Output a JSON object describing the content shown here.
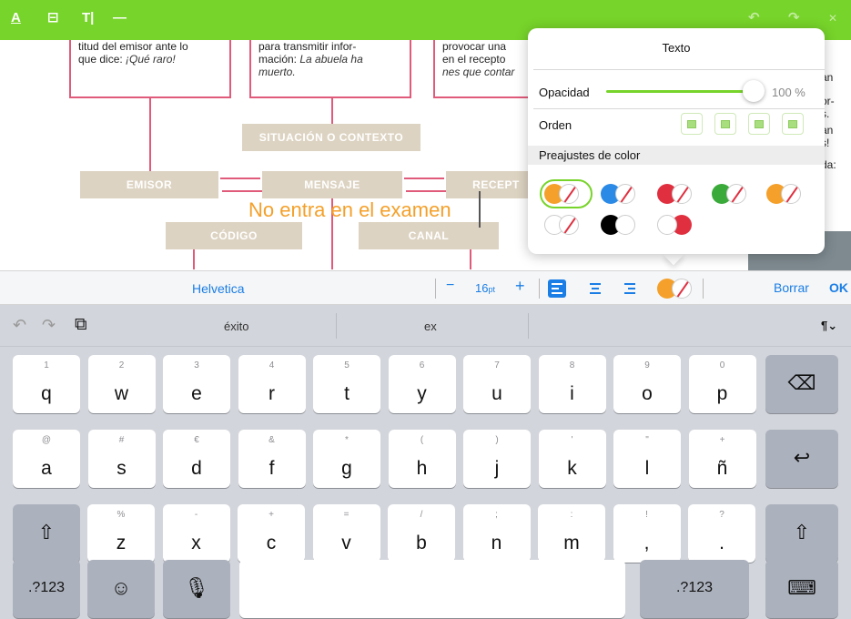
{
  "toolbar": {
    "icons": [
      "text-format-icon",
      "comment-icon",
      "text-tool-icon",
      "line-icon",
      "undo-icon",
      "redo-icon",
      "close-icon"
    ],
    "glyph_format": "A",
    "glyph_comment": "⊟",
    "glyph_text": "T|",
    "glyph_line": "—",
    "glyph_undo": "↶",
    "glyph_redo": "↷",
    "glyph_close": "✕",
    "color": "#77d42a"
  },
  "document": {
    "card1_line1": "titud del emisor ante lo",
    "card1_line2_a": "que dice: ",
    "card1_line2_b": "¡Qué raro!",
    "card2_line1": "para transmitir infor-",
    "card2_line2_a": "mación: ",
    "card2_line2_b": "La abuela ha",
    "card2_line3": "muerto.",
    "card3_line1": "provocar una",
    "card3_line2": "en el recepto",
    "card3_line3": "nes que contar",
    "right_frag1": "an",
    "right_frag2": "or-",
    "right_frag3": "s.",
    "right_frag4": "an",
    "right_frag5": "s!",
    "right_frag6": "da:",
    "tag_situacion": "SITUACIÓN O CONTEXTO",
    "tag_emisor": "EMISOR",
    "tag_mensaje": "MENSAJE",
    "tag_receptor": "RECEPT",
    "tag_codigo": "CÓDIGO",
    "tag_canal": "CANAL",
    "overlay_text": "No entra en el examen",
    "overlay_color": "#f4a02a",
    "arrow_color": "#e05a7a",
    "tag_color": "#ddd3c2"
  },
  "popover": {
    "title": "Texto",
    "opacity_label": "Opacidad",
    "opacity_value": "100 %",
    "order_label": "Orden",
    "presets_label": "Preajustes de color",
    "presets": [
      {
        "name": "orange",
        "color": "#f4a02a"
      },
      {
        "name": "blue",
        "color": "#2a8ae6"
      },
      {
        "name": "red",
        "color": "#e03040"
      },
      {
        "name": "green",
        "color": "#3aaa3a"
      },
      {
        "name": "orange-2",
        "color": "#f4a02a"
      },
      {
        "name": "white",
        "color": "#ffffff"
      },
      {
        "name": "black",
        "color": "#000000"
      },
      {
        "name": "red-2",
        "color": "#e03040"
      }
    ],
    "selected_preset": "orange"
  },
  "format_bar": {
    "font": "Helvetica",
    "minus": "−",
    "size": "16",
    "size_unit": "pt",
    "plus": "+",
    "align_left": "align-left-icon",
    "align_center": "align-center-icon",
    "align_right": "align-right-icon",
    "active_align": "left",
    "color": "#f4a02a",
    "delete_label": "Borrar",
    "ok_label": "OK",
    "accent": "#1a7ee6"
  },
  "keyboard": {
    "undo_glyph": "↶",
    "redo_glyph": "↷",
    "paste_glyph": "⧉",
    "suggestions": [
      "éxito",
      "ex",
      ""
    ],
    "para_glyph": "¶⌄",
    "row1": [
      {
        "hint": "1",
        "key": "q"
      },
      {
        "hint": "2",
        "key": "w"
      },
      {
        "hint": "3",
        "key": "e"
      },
      {
        "hint": "4",
        "key": "r"
      },
      {
        "hint": "5",
        "key": "t"
      },
      {
        "hint": "6",
        "key": "y"
      },
      {
        "hint": "7",
        "key": "u"
      },
      {
        "hint": "8",
        "key": "i"
      },
      {
        "hint": "9",
        "key": "o"
      },
      {
        "hint": "0",
        "key": "p"
      }
    ],
    "row2": [
      {
        "hint": "@",
        "key": "a"
      },
      {
        "hint": "#",
        "key": "s"
      },
      {
        "hint": "€",
        "key": "d"
      },
      {
        "hint": "&",
        "key": "f"
      },
      {
        "hint": "*",
        "key": "g"
      },
      {
        "hint": "(",
        "key": "h"
      },
      {
        "hint": ")",
        "key": "j"
      },
      {
        "hint": "'",
        "key": "k"
      },
      {
        "hint": "\"",
        "key": "l"
      },
      {
        "hint": "+",
        "key": "ñ"
      }
    ],
    "row3": [
      {
        "hint": "%",
        "key": "z"
      },
      {
        "hint": "-",
        "key": "x"
      },
      {
        "hint": "+",
        "key": "c"
      },
      {
        "hint": "=",
        "key": "v"
      },
      {
        "hint": "/",
        "key": "b"
      },
      {
        "hint": ";",
        "key": "n"
      },
      {
        "hint": ":",
        "key": "m"
      },
      {
        "hint": "!",
        "key": ","
      },
      {
        "hint": "?",
        "key": "."
      }
    ],
    "backspace_glyph": "⌫",
    "return_glyph": "↩",
    "shift_glyph": "⇧",
    "numbers_label": ".?123",
    "emoji_glyph": "☺",
    "mic_glyph": "🎙",
    "hide_glyph": "⌨"
  }
}
